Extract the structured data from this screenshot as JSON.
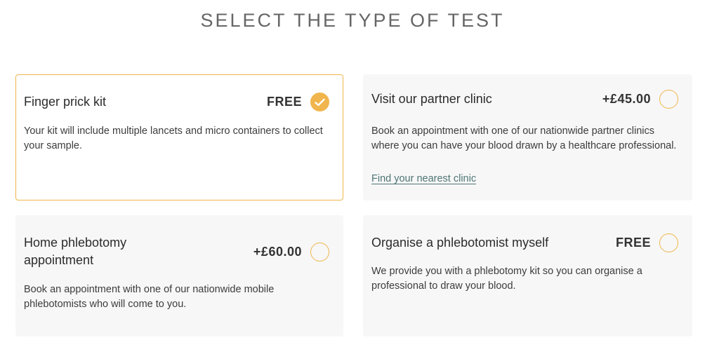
{
  "page": {
    "title": "SELECT THE TYPE OF TEST"
  },
  "colors": {
    "accent": "#f0b54c",
    "card_background": "#f7f7f7",
    "link": "#4e7474"
  },
  "options": [
    {
      "title": "Finger prick kit",
      "price": "FREE",
      "selected": true,
      "description": "Your kit will include multiple lancets and micro containers to collect your sample.",
      "icon": "check-icon"
    },
    {
      "title": "Visit our partner clinic",
      "price": "+£45.00",
      "selected": false,
      "description": "Book an appointment with one of our nationwide partner clinics where you can have your blood drawn by a healthcare professional.",
      "link_text": "Find your nearest clinic"
    },
    {
      "title": "Home phlebotomy appointment",
      "price": "+£60.00",
      "selected": false,
      "description": "Book an appointment with one of our nationwide mobile phlebotomists who will come to you."
    },
    {
      "title": "Organise a phlebotomist myself",
      "price": "FREE",
      "selected": false,
      "description": "We provide you with a phlebotomy kit so you can organise a professional to draw your blood."
    }
  ]
}
